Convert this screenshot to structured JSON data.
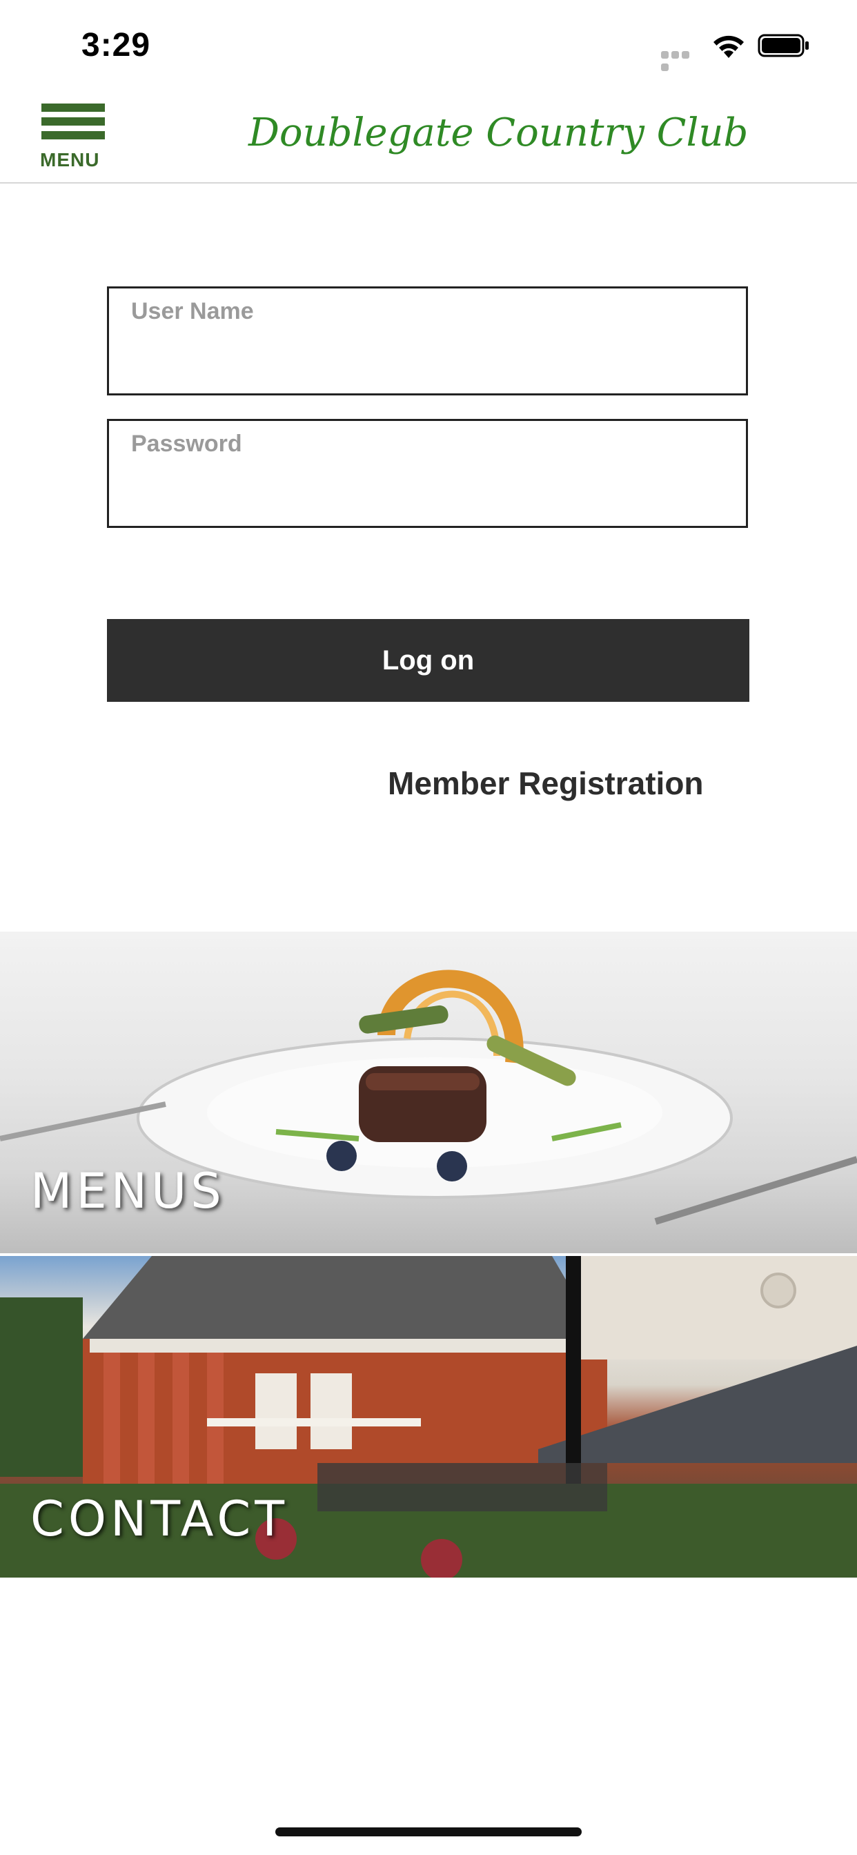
{
  "status_bar": {
    "time": "3:29"
  },
  "nav": {
    "menu_label": "MENU",
    "club_name": "Doublegate Country Club",
    "brand_color": "#3b6a2b",
    "logo_color": "#2f8a25"
  },
  "login": {
    "username_label": "User Name",
    "username_value": "",
    "password_label": "Password",
    "password_value": "",
    "logon_label": "Log on",
    "registration_label": "Member Registration"
  },
  "tiles": {
    "menus_label": "MENUS",
    "contact_label": "CONTACT"
  },
  "icons": [
    "signal-icon",
    "wifi-icon",
    "battery-icon",
    "hamburger-menu-icon"
  ]
}
